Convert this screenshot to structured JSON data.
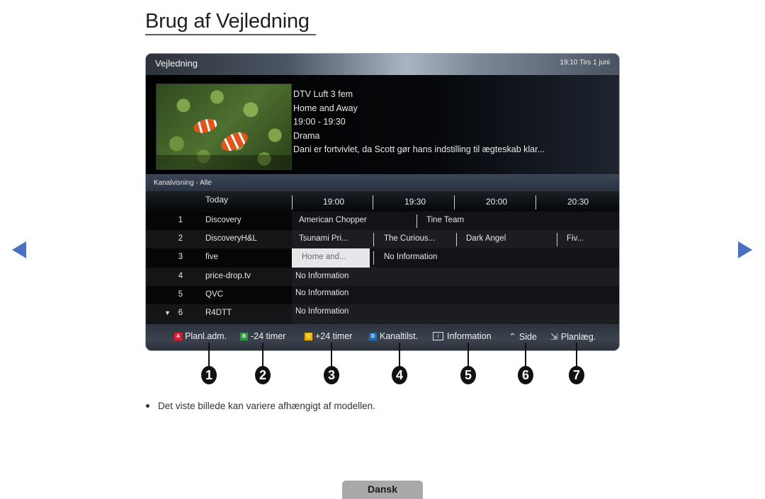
{
  "page": {
    "title": "Brug af Vejledning",
    "note": "Det viste billede kan variere afhængigt af modellen.",
    "language_tab": "Dansk",
    "nav": {
      "prev_icon": "triangle-left-icon",
      "next_icon": "triangle-right-icon",
      "arrow_color": "#4a70c2"
    }
  },
  "guide": {
    "header": {
      "title": "Vejledning",
      "clock": "19:10 Tirs 1 juni"
    },
    "preview": {
      "thumbnail": "clownfish-preview-image",
      "channel": "DTV Luft 3 fem",
      "program": "Home and Away",
      "time": "19:00 - 19:30",
      "genre": "Drama",
      "description": "Dani er fortvivlet, da Scott gør hans indstilling til ægteskab klar..."
    },
    "view_label": "Kanalvisning - Alle",
    "time_header": {
      "day": "Today",
      "slots": [
        "19:00",
        "19:30",
        "20:00",
        "20:30"
      ]
    },
    "channels": [
      {
        "num": "1",
        "name": "Discovery",
        "programs": [
          "American Chopper",
          "Tine Team"
        ]
      },
      {
        "num": "2",
        "name": "DiscoveryH&L",
        "programs": [
          "Tsunami Pri...",
          "The Curious...",
          "Dark Angel",
          "Fiv..."
        ]
      },
      {
        "num": "3",
        "name": "five",
        "programs": [
          "Home and...",
          "No Information"
        ],
        "selected_program": 0
      },
      {
        "num": "4",
        "name": "price-drop.tv",
        "programs": [
          "No Information"
        ]
      },
      {
        "num": "5",
        "name": "QVC",
        "programs": [
          "No Information"
        ]
      },
      {
        "num": "6",
        "name": "R4DTT",
        "programs": [
          "No Information"
        ],
        "more_indicator": "▼"
      }
    ],
    "footer": [
      {
        "key": "A",
        "key_color": "#e02030",
        "label": "Planl.adm."
      },
      {
        "key": "B",
        "key_color": "#2a9a3a",
        "label": "-24 timer"
      },
      {
        "key": "C",
        "key_color": "#f0b000",
        "label": "+24 timer"
      },
      {
        "key": "D",
        "key_color": "#1d6fc0",
        "label": "Kanaltilst."
      },
      {
        "icon": "info-icon",
        "glyph": "i",
        "label": "Information"
      },
      {
        "icon": "up-down-icon",
        "glyph": "◇",
        "label": "Side"
      },
      {
        "icon": "schedule-icon",
        "glyph": "⇲",
        "label": "Planlæg."
      }
    ]
  },
  "callouts": [
    "1",
    "2",
    "3",
    "4",
    "5",
    "6",
    "7"
  ]
}
